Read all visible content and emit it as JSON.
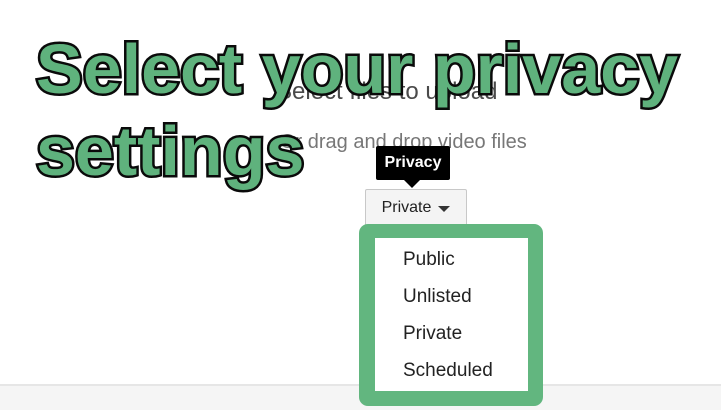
{
  "upload": {
    "title": "Select files to upload",
    "drag_text": "Or drag and drop video files"
  },
  "overlay": {
    "line1": "Select your privacy",
    "line2": "settings"
  },
  "privacy": {
    "tooltip": "Privacy",
    "selected": "Private",
    "options": [
      "Public",
      "Unlisted",
      "Private",
      "Scheduled"
    ]
  },
  "colors": {
    "highlight": "#62b67f",
    "tooltip_bg": "#000000"
  }
}
